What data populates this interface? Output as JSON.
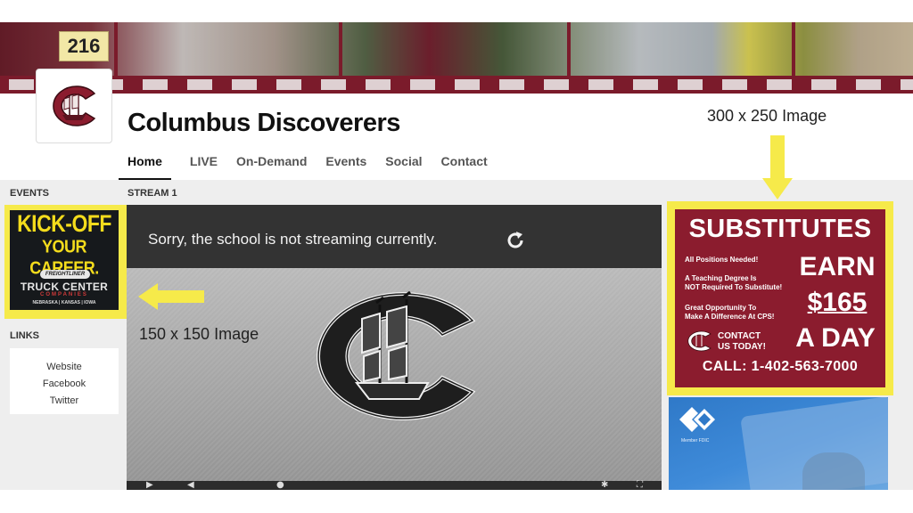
{
  "site": {
    "title": "Columbus Discoverers",
    "banner_bib_number": "216"
  },
  "nav": {
    "items": [
      {
        "label": "Home",
        "active": true
      },
      {
        "label": "LIVE",
        "active": false
      },
      {
        "label": "On-Demand",
        "active": false
      },
      {
        "label": "Events",
        "active": false
      },
      {
        "label": "Social",
        "active": false
      },
      {
        "label": "Contact",
        "active": false
      }
    ]
  },
  "sidebar": {
    "events_label": "EVENTS",
    "links_label": "LINKS",
    "links": [
      "Website",
      "Facebook",
      "Twitter"
    ],
    "event_ad": {
      "line1": "KICK-OFF",
      "line2": "YOUR CAREER.",
      "brand_pill": "FREIGHTLINER",
      "brand": "TRUCK CENTER",
      "brand_sub": "COMPANIES",
      "states": "NEBRASKA | KANSAS | IOWA"
    }
  },
  "stream": {
    "label": "STREAM 1",
    "message": "Sorry, the school is not streaming currently."
  },
  "annotations": {
    "small_image": "150 x 150 Image",
    "large_image": "300 x 250 Image"
  },
  "right_ad": {
    "headline": "SUBSTITUTES",
    "line_positions": "All Positions Needed!",
    "line_degree_1": "A Teaching Degree Is",
    "line_degree_2": "NOT Required To Substitute!",
    "line_opportunity_1": "Great Opportunity To",
    "line_opportunity_2": "Make A Difference At CPS!",
    "earn": "EARN",
    "price": "$165",
    "per": "A DAY",
    "contact_1": "CONTACT",
    "contact_2": "US TODAY!",
    "call": "CALL: 1-402-563-7000"
  },
  "bank_ad": {
    "fdic": "Member FDIC"
  },
  "colors": {
    "brand_maroon": "#8b1c2e",
    "highlight_yellow": "#f6ea4a",
    "player_message_bg": "#333333"
  }
}
